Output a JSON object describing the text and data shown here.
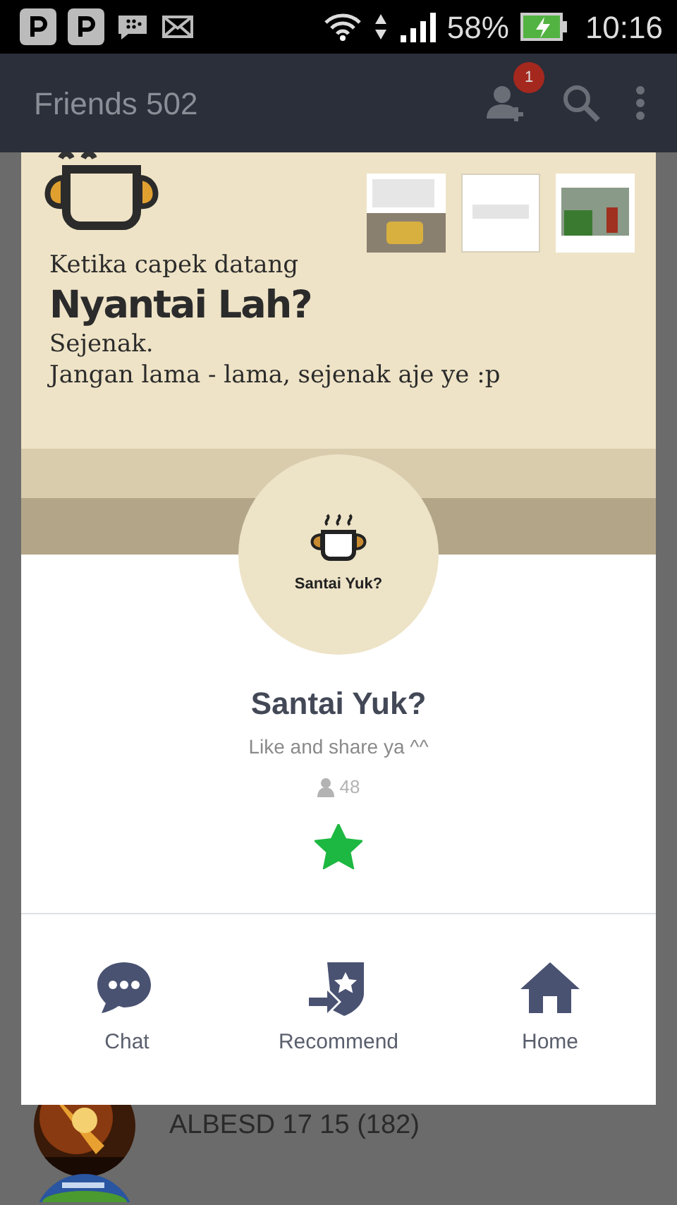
{
  "status_bar": {
    "battery": "58%",
    "time": "10:16"
  },
  "header": {
    "title": "Friends 502",
    "badge": "1"
  },
  "profile": {
    "cover": {
      "lines": [
        {
          "kind": "serif",
          "text": "Ketika capek datang"
        },
        {
          "kind": "headline",
          "text": "Nyantai Lah?"
        },
        {
          "kind": "serif",
          "text": "Sejenak."
        },
        {
          "kind": "serif",
          "text": "Jangan lama - lama, sejenak aje ye :p"
        }
      ]
    },
    "avatar_caption": "Santai Yuk?",
    "name": "Santai Yuk?",
    "status": "Like and share ya ^^",
    "followers": "48",
    "favorite": true
  },
  "actions": [
    {
      "kind": "chat",
      "label": "Chat"
    },
    {
      "kind": "recommend",
      "label": "Recommend"
    },
    {
      "kind": "home",
      "label": "Home"
    }
  ],
  "friends": [
    {
      "name": "ALBESD 17 15 (182)"
    }
  ]
}
